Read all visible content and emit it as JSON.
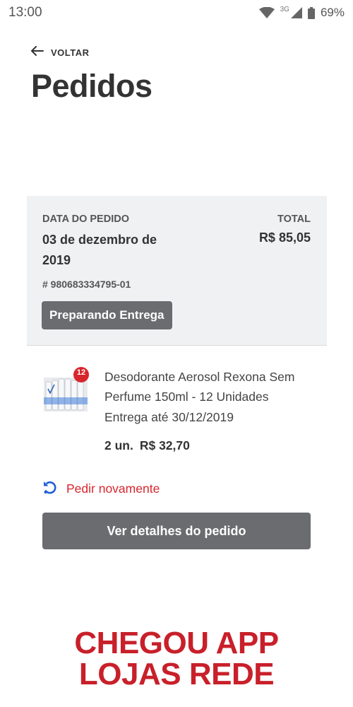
{
  "status_bar": {
    "time": "13:00",
    "network": "3G",
    "battery": "69%"
  },
  "header": {
    "back_label": "VOLTAR",
    "title": "Pedidos"
  },
  "order": {
    "date_label": "DATA DO PEDIDO",
    "date_value": "03 de dezembro de 2019",
    "total_label": "TOTAL",
    "total_value": "R$ 85,05",
    "number": "# 980683334795-01",
    "status": "Preparando Entrega"
  },
  "product": {
    "image_badge": "12",
    "name": "Desodorante Aerosol Rexona Sem Perfume 150ml - 12 Unidades",
    "delivery": "Entrega até 30/12/2019",
    "quantity": "2 un.",
    "price": "R$ 32,70"
  },
  "actions": {
    "reorder_label": "Pedir novamente",
    "details_label": "Ver detalhes do pedido"
  },
  "promo": {
    "line1": "CHEGOU APP",
    "line2": "LOJAS REDE"
  },
  "colors": {
    "accent_red": "#d8252c",
    "button_gray": "#6b6c6f",
    "card_bg": "#f0f1f3",
    "reorder_icon_blue": "#1f5fd6"
  }
}
